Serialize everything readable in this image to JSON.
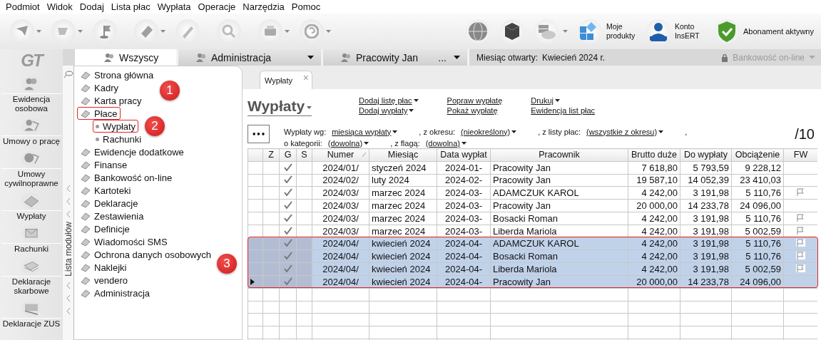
{
  "menu_bar": [
    "Podmiot",
    "Widok",
    "Dodaj",
    "Lista płac",
    "Wypłata",
    "Operacje",
    "Narzędzia",
    "Pomoc"
  ],
  "toolbar": {
    "buttons": [
      {
        "has_menu": true
      },
      {
        "has_menu": true
      },
      {
        "has_menu": false
      },
      {
        "has_menu": true
      },
      {
        "has_menu": false
      },
      {
        "has_menu": false
      },
      {
        "has_menu": true
      },
      {
        "has_menu": true
      }
    ],
    "right_buttons": [
      {
        "kind": "globe"
      },
      {
        "kind": "cube"
      },
      {
        "kind": "cloud",
        "has_menu": true
      },
      {
        "kind": "products",
        "label": "Moje produkty"
      },
      {
        "kind": "account",
        "label": "Konto InsERT"
      },
      {
        "kind": "shield",
        "label": "Abonament aktywny"
      }
    ]
  },
  "logo": "GT",
  "context_tabs": [
    {
      "label": "Wszyscy",
      "selected": true,
      "has_menu": false
    },
    {
      "label": "Administracja",
      "selected": false,
      "has_menu": true
    },
    {
      "label": "Pracowity Jan",
      "suffix": "...",
      "selected": false,
      "has_menu": true
    }
  ],
  "open_month": {
    "label": "Miesiąc otwarty:",
    "value": "Kwiecień 2024 r."
  },
  "banking": {
    "label": "Bankowość on-line",
    "disabled": true
  },
  "quick_bar": [
    {
      "label": "Ewidencja osobowa"
    },
    {
      "label": "Umowy o pracę"
    },
    {
      "label": "Umowy cywilnoprawne"
    },
    {
      "label": "Wypłaty"
    },
    {
      "label": "Rachunki"
    },
    {
      "label": "Deklaracje skarbowe"
    },
    {
      "label": "Deklaracje ZUS"
    }
  ],
  "module_list": {
    "title": "Lista modułów",
    "items": [
      {
        "label": "Strona główna",
        "highlighted": false
      },
      {
        "label": "Kadry",
        "highlighted": false
      },
      {
        "label": "Karta pracy",
        "highlighted": false
      },
      {
        "label": "Płace",
        "highlighted": true,
        "children": [
          {
            "label": "Wypłaty",
            "highlighted": true
          },
          {
            "label": "Rachunki",
            "highlighted": false
          }
        ]
      },
      {
        "label": "Ewidencje dodatkowe",
        "highlighted": false
      },
      {
        "label": "Finanse",
        "highlighted": false
      },
      {
        "label": "Bankowość on-line",
        "highlighted": false
      },
      {
        "label": "Kartoteki",
        "highlighted": false
      },
      {
        "label": "Deklaracje",
        "highlighted": false
      },
      {
        "label": "Zestawienia",
        "highlighted": false
      },
      {
        "label": "Definicje",
        "highlighted": false
      },
      {
        "label": "Wiadomości SMS",
        "highlighted": false
      },
      {
        "label": "Ochrona danych osobowych",
        "highlighted": false
      },
      {
        "label": "Naklejki",
        "highlighted": false
      },
      {
        "label": "vendero",
        "highlighted": false
      },
      {
        "label": "Administracja",
        "highlighted": false
      }
    ]
  },
  "document_tab": {
    "label": "Wypłaty",
    "close": "×"
  },
  "view": {
    "title": "Wypłaty",
    "actions": [
      [
        "Dodaj listę płac",
        "Dodaj wypłaty"
      ],
      [
        "Popraw wypłatę",
        "Pokaż wypłatę"
      ],
      [
        "Drukuj",
        "Ewidencja list płac"
      ]
    ],
    "action_menus": [
      [
        true,
        true
      ],
      [
        false,
        false
      ],
      [
        true,
        false
      ]
    ],
    "more": "•••",
    "filters": [
      [
        {
          "label": "Wypłaty wg:",
          "value": "miesiąca wypłaty"
        },
        {
          "label": ", z okresu:",
          "value": "(nieokreślony)"
        },
        {
          "label": ", z listy płac:",
          "value": "(wszystkie z okresu)"
        },
        {
          "label": ","
        }
      ],
      [
        {
          "label": "o kategorii:",
          "value": "(dowolna)"
        },
        {
          "label": ", z flagą:",
          "value": "(dowolna)"
        }
      ]
    ],
    "count": "/10"
  },
  "table": {
    "columns": [
      "",
      "Z",
      "G",
      "S",
      "Numer",
      "Miesiąc",
      "Data wypłat",
      "Pracownik",
      "Brutto duże",
      "Do wypłaty",
      "Obciążenie",
      "FW"
    ],
    "rows": [
      {
        "g": true,
        "flag": false,
        "selected": false,
        "current": false,
        "cells": [
          "",
          "",
          "",
          "",
          "2024/01/",
          "styczeń 2024",
          "2024-01-",
          "Pracowity Jan",
          "7 618,80",
          "5 793,59",
          "9 228,12",
          ""
        ]
      },
      {
        "g": true,
        "flag": false,
        "selected": false,
        "current": false,
        "cells": [
          "",
          "",
          "",
          "",
          "2024/02/",
          "luty 2024",
          "2024-02-",
          "Pracowity Jan",
          "19 587,10",
          "14 052,39",
          "23 410,03",
          ""
        ]
      },
      {
        "g": true,
        "flag": true,
        "selected": false,
        "current": false,
        "cells": [
          "",
          "",
          "",
          "",
          "2024/03/",
          "marzec 2024",
          "2024-03-",
          "ADAMCZUK KAROL",
          "4 242,00",
          "3 191,98",
          "5 110,76",
          ""
        ]
      },
      {
        "g": true,
        "flag": false,
        "selected": false,
        "current": false,
        "cells": [
          "",
          "",
          "",
          "",
          "2024/03/",
          "marzec 2024",
          "2024-03-",
          "Pracowity Jan",
          "20 000,00",
          "14 233,78",
          "24 096,00",
          ""
        ]
      },
      {
        "g": true,
        "flag": true,
        "selected": false,
        "current": false,
        "cells": [
          "",
          "",
          "",
          "",
          "2024/03/",
          "marzec 2024",
          "2024-03-",
          "Bosacki Roman",
          "4 242,00",
          "3 191,98",
          "5 110,76",
          ""
        ]
      },
      {
        "g": true,
        "flag": true,
        "selected": false,
        "current": false,
        "cells": [
          "",
          "",
          "",
          "",
          "2024/03/",
          "marzec 2024",
          "2024-03-",
          "Liberda Mariola",
          "4 242,00",
          "3 191,98",
          "5 002,59",
          ""
        ]
      },
      {
        "g": true,
        "flag": true,
        "selected": true,
        "current": false,
        "cells": [
          "",
          "",
          "",
          "",
          "2024/04/",
          "kwiecień 2024",
          "2024-04-",
          "ADAMCZUK KAROL",
          "4 242,00",
          "3 191,98",
          "5 110,76",
          ""
        ]
      },
      {
        "g": true,
        "flag": true,
        "selected": true,
        "current": false,
        "cells": [
          "",
          "",
          "",
          "",
          "2024/04/",
          "kwiecień 2024",
          "2024-04-",
          "Bosacki Roman",
          "4 242,00",
          "3 191,98",
          "5 110,76",
          ""
        ]
      },
      {
        "g": true,
        "flag": true,
        "selected": true,
        "current": false,
        "cells": [
          "",
          "",
          "",
          "",
          "2024/04/",
          "kwiecień 2024",
          "2024-04-",
          "Liberda Mariola",
          "4 242,00",
          "3 191,98",
          "5 002,59",
          ""
        ]
      },
      {
        "g": true,
        "flag": false,
        "selected": true,
        "current": true,
        "cells": [
          "",
          "",
          "",
          "",
          "2024/04/",
          "kwiecień 2024",
          "2024-04-",
          "Pracowity Jan",
          "20 000,00",
          "14 233,78",
          "24 096,00",
          ""
        ]
      }
    ]
  },
  "annotations": [
    {
      "label": "1"
    },
    {
      "label": "2"
    },
    {
      "label": "3"
    }
  ]
}
